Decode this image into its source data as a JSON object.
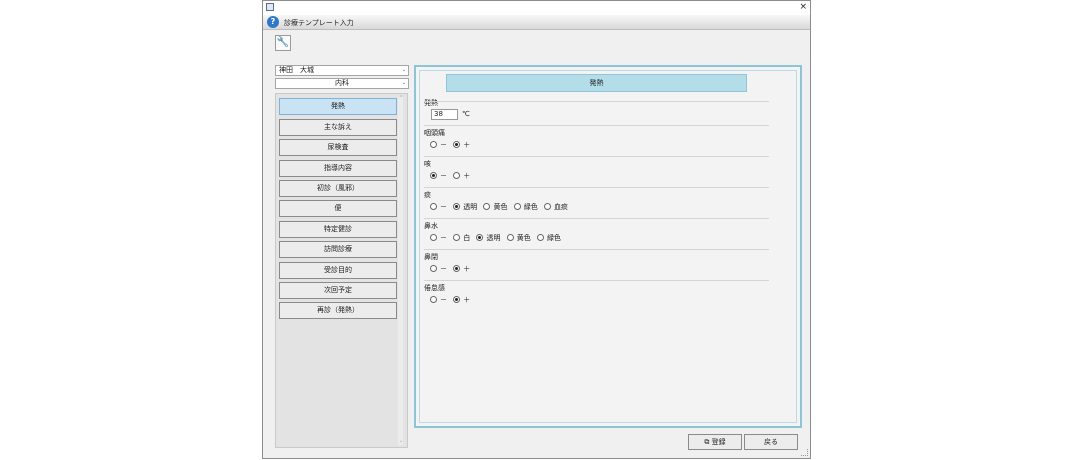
{
  "window": {
    "title": "診療テンプレート入力",
    "help_symbol": "?",
    "close_symbol": "×"
  },
  "toolbar": {
    "tool_glyph": "🔧"
  },
  "doctor_select": {
    "value": "神田　大城",
    "caret": "⌄"
  },
  "dept_select": {
    "value": "内科",
    "caret": "⌄"
  },
  "menu": {
    "items": [
      {
        "label": "発熱"
      },
      {
        "label": "主な訴え"
      },
      {
        "label": "尿検査"
      },
      {
        "label": "指導内容"
      },
      {
        "label": "初診（風邪）"
      },
      {
        "label": "便"
      },
      {
        "label": "特定健診"
      },
      {
        "label": "訪問診療"
      },
      {
        "label": "受診目的"
      },
      {
        "label": "次回予定"
      },
      {
        "label": "再診（発熱）"
      }
    ],
    "active_index": 0,
    "scroll_up": "⌃",
    "scroll_down": "⌄"
  },
  "form": {
    "header": "発熱",
    "temperature": {
      "label": "発熱",
      "value": "38",
      "unit": "℃"
    },
    "sections": [
      {
        "label": "咽頭痛",
        "options": [
          "－",
          "＋"
        ],
        "selected": 1
      },
      {
        "label": "咳",
        "options": [
          "－",
          "＋"
        ],
        "selected": 0
      },
      {
        "label": "痰",
        "options": [
          "－",
          "透明",
          "黄色",
          "緑色",
          "血痰"
        ],
        "selected": 1
      },
      {
        "label": "鼻水",
        "options": [
          "－",
          "白",
          "透明",
          "黄色",
          "緑色"
        ],
        "selected": 2
      },
      {
        "label": "鼻閉",
        "options": [
          "－",
          "＋"
        ],
        "selected": 1
      },
      {
        "label": "倦怠感",
        "options": [
          "－",
          "＋"
        ],
        "selected": 1
      }
    ]
  },
  "footer": {
    "register_label": "登録",
    "register_icon": "⧉",
    "back_label": "戻る"
  }
}
